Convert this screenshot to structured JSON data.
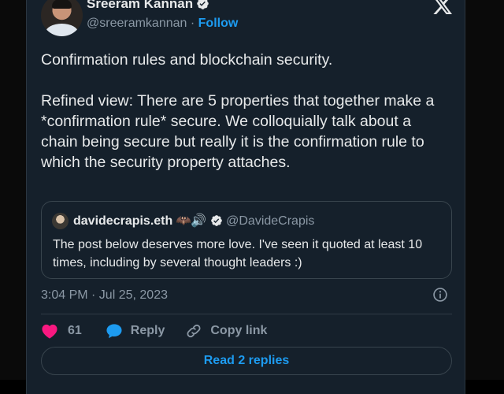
{
  "author": {
    "name": "Sreeram Kannan",
    "handle": "@sreeramkannan",
    "separator": "·",
    "follow_label": "Follow"
  },
  "tweet": {
    "paragraphs": [
      "Confirmation rules and blockchain security.",
      "Refined view: There are 5 properties that together make a *confirmation rule* secure. We colloquially talk about a chain being secure but really it is the confirmation rule to which the security property attaches."
    ]
  },
  "quote": {
    "name": "davidecrapis.eth",
    "emoji": "🦇🔊",
    "handle": "@DavideCrapis",
    "text": "The post below deserves more love. I've seen it quoted at least 10 times, including by several thought leaders :)"
  },
  "meta": {
    "timestamp": "3:04 PM · Jul 25, 2023"
  },
  "actions": {
    "like_count": "61",
    "reply_label": "Reply",
    "copy_label": "Copy link",
    "read_replies_label": "Read 2 replies"
  },
  "colors": {
    "background": "#15202b",
    "text": "#e7e9ea",
    "muted": "#8b98a5",
    "accent": "#1d9bf0",
    "like": "#f91880",
    "border": "#38444d"
  },
  "icons": {
    "verified": "verified-badge-icon",
    "x_logo": "x-logo-icon",
    "info": "info-icon",
    "like": "heart-icon",
    "reply": "speech-bubble-icon",
    "copy": "link-icon"
  }
}
